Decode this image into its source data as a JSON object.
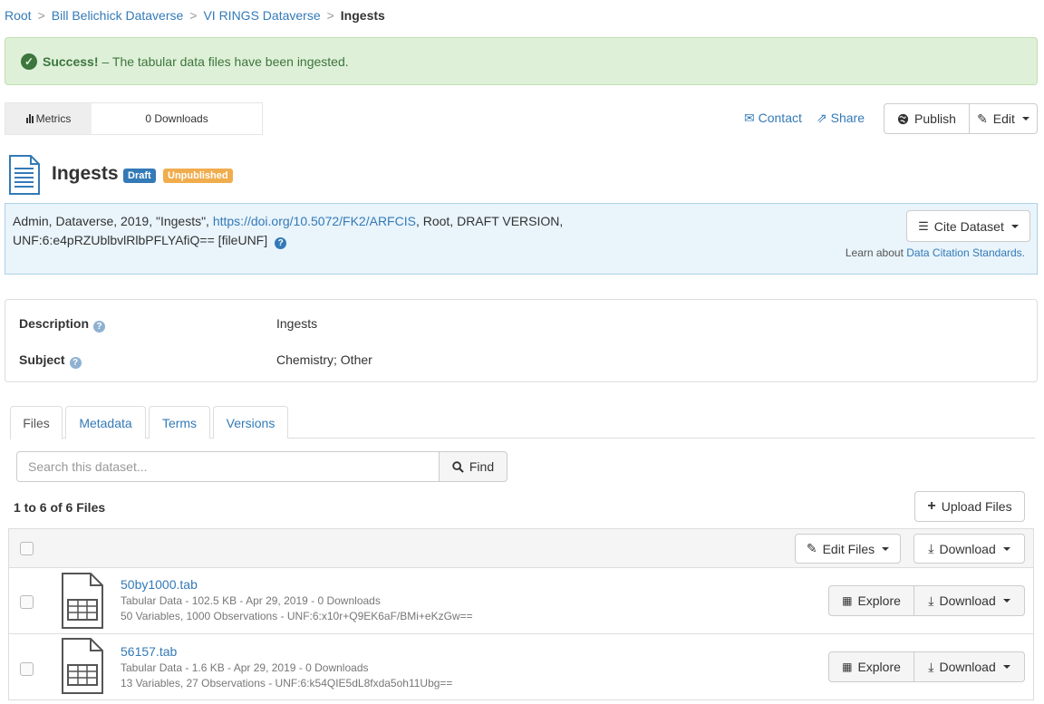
{
  "breadcrumb": {
    "items": [
      "Root",
      "Bill Belichick Dataverse",
      "VI RINGS Dataverse"
    ],
    "current": "Ingests",
    "separator": ">"
  },
  "alert": {
    "strong": "Success!",
    "message": "– The tabular data files have been ingested."
  },
  "metrics": {
    "label": "Metrics",
    "downloads": "0 Downloads"
  },
  "actions": {
    "contact": "Contact",
    "share": "Share",
    "publish": "Publish",
    "edit": "Edit"
  },
  "dataset": {
    "title": "Ingests",
    "badges": {
      "draft": "Draft",
      "unpublished": "Unpublished"
    }
  },
  "citation": {
    "prefix": "Admin, Dataverse, 2019, \"Ingests\", ",
    "doi": "https://doi.org/10.5072/FK2/ARFCIS",
    "suffix": ", Root, DRAFT VERSION,",
    "unf": "UNF:6:e4pRZUblbvlRlbPFLYAfiQ== [fileUNF]",
    "cite_button": "Cite Dataset",
    "learn_prefix": "Learn about ",
    "learn_link": "Data Citation Standards."
  },
  "summary": {
    "description_label": "Description",
    "description_value": "Ingests",
    "subject_label": "Subject",
    "subject_value": "Chemistry; Other"
  },
  "tabs": [
    "Files",
    "Metadata",
    "Terms",
    "Versions"
  ],
  "search": {
    "placeholder": "Search this dataset...",
    "find": "Find"
  },
  "files": {
    "count": "1 to 6 of 6 Files",
    "upload": "Upload Files",
    "edit_files": "Edit Files",
    "download": "Download",
    "explore": "Explore",
    "rows": [
      {
        "name": "50by1000.tab",
        "meta1": "Tabular Data - 102.5 KB - Apr 29, 2019 - 0 Downloads",
        "meta2": "50 Variables, 1000 Observations - UNF:6:x10r+Q9EK6aF/BMi+eKzGw=="
      },
      {
        "name": "56157.tab",
        "meta1": "Tabular Data - 1.6 KB - Apr 29, 2019 - 0 Downloads",
        "meta2": "13 Variables, 27 Observations - UNF:6:k54QIE5dL8fxda5oh11Ubg=="
      }
    ]
  },
  "colors": {
    "link": "#337ab7",
    "success_bg": "#dff0d8",
    "draft_badge": "#337ab7",
    "unpublished_badge": "#f0ad4e"
  }
}
